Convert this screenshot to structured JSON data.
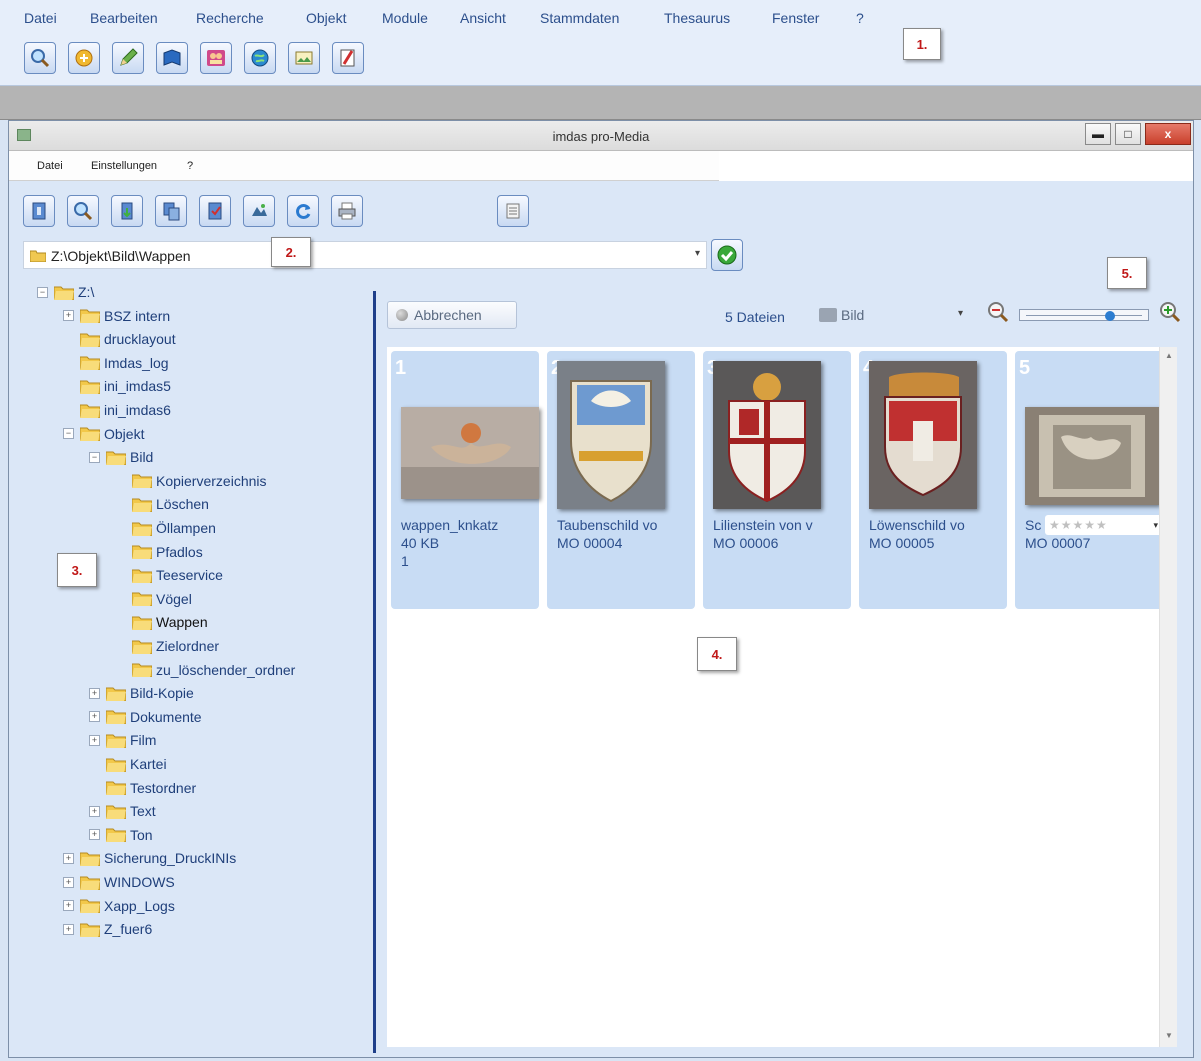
{
  "app_menu": [
    "Datei",
    "Bearbeiten",
    "Recherche",
    "Objekt",
    "Module",
    "Ansicht",
    "Stammdaten",
    "Thesaurus",
    "Fenster",
    "?"
  ],
  "app_toolbar_icons": [
    "search-icon",
    "folder-open-icon",
    "pencil-icon",
    "book-icon",
    "persons-icon",
    "globe-icon",
    "image-icon",
    "checklist-icon"
  ],
  "callouts": {
    "c1": "1.",
    "c2": "2.",
    "c3": "3.",
    "c4": "4.",
    "c5": "5."
  },
  "window": {
    "title": "imdas pro-Media",
    "menu": [
      "Datei",
      "Einstellungen",
      "?"
    ],
    "controls": {
      "minimize": "▬",
      "maximize": "□",
      "close": "x"
    }
  },
  "win_toolbar_icons": [
    "exit-icon",
    "search-icon",
    "import-icon",
    "copy-icon",
    "check-icon",
    "images-icon",
    "refresh-icon",
    "print-icon",
    "list-icon"
  ],
  "path": {
    "value": "Z:\\Objekt\\Bild\\Wappen",
    "dropdown": "▾"
  },
  "tree": [
    {
      "label": "Z:\\",
      "level": 0,
      "toggle": "−"
    },
    {
      "label": "BSZ intern",
      "level": 1,
      "toggle": "+"
    },
    {
      "label": "drucklayout",
      "level": 1,
      "toggle": ""
    },
    {
      "label": "Imdas_log",
      "level": 1,
      "toggle": ""
    },
    {
      "label": "ini_imdas5",
      "level": 1,
      "toggle": ""
    },
    {
      "label": "ini_imdas6",
      "level": 1,
      "toggle": ""
    },
    {
      "label": "Objekt",
      "level": 1,
      "toggle": "−"
    },
    {
      "label": "Bild",
      "level": 2,
      "toggle": "−"
    },
    {
      "label": "Kopierverzeichnis",
      "level": 3,
      "toggle": ""
    },
    {
      "label": "Löschen",
      "level": 3,
      "toggle": ""
    },
    {
      "label": "Öllampen",
      "level": 3,
      "toggle": ""
    },
    {
      "label": "Pfadlos",
      "level": 3,
      "toggle": ""
    },
    {
      "label": "Teeservice",
      "level": 3,
      "toggle": ""
    },
    {
      "label": "Vögel",
      "level": 3,
      "toggle": ""
    },
    {
      "label": "Wappen",
      "level": 3,
      "toggle": "",
      "selected": true
    },
    {
      "label": "Zielordner",
      "level": 3,
      "toggle": ""
    },
    {
      "label": "zu_löschender_ordner",
      "level": 3,
      "toggle": ""
    },
    {
      "label": "Bild-Kopie",
      "level": 2,
      "toggle": "+"
    },
    {
      "label": "Dokumente",
      "level": 2,
      "toggle": "+"
    },
    {
      "label": "Film",
      "level": 2,
      "toggle": "+"
    },
    {
      "label": "Kartei",
      "level": 2,
      "toggle": ""
    },
    {
      "label": "Testordner",
      "level": 2,
      "toggle": ""
    },
    {
      "label": "Text",
      "level": 2,
      "toggle": "+"
    },
    {
      "label": "Ton",
      "level": 2,
      "toggle": "+"
    },
    {
      "label": "Sicherung_DruckINIs",
      "level": 1,
      "toggle": "+"
    },
    {
      "label": "WINDOWS",
      "level": 1,
      "toggle": "+"
    },
    {
      "label": "Xapp_Logs",
      "level": 1,
      "toggle": "+"
    },
    {
      "label": "Z_fuer6",
      "level": 1,
      "toggle": "+"
    }
  ],
  "right": {
    "cancel_label": "Abbrechen",
    "file_count": "5 Dateien",
    "type_select": "Bild",
    "zoom_level": 0.7
  },
  "cards": [
    {
      "num": "1",
      "line1": "wappen_knkatz",
      "line2": "40 KB",
      "line3": "1",
      "thumb": "landscape-beige"
    },
    {
      "num": "2",
      "line1": "Taubenschild vo",
      "line2": "MO 00004",
      "line3": "",
      "thumb": "shield-dove"
    },
    {
      "num": "3",
      "line1": "Lilienstein von v",
      "line2": "MO 00006",
      "line3": "",
      "thumb": "shield-lily"
    },
    {
      "num": "4",
      "line1": "Löwenschild vo",
      "line2": "MO 00005",
      "line3": "",
      "thumb": "shield-lion"
    },
    {
      "num": "5",
      "line1": "Sc",
      "line2": "MO 00007",
      "line3": "",
      "thumb": "stone-relief",
      "rating": "★★★★★"
    }
  ],
  "colors": {
    "accent": "#2c4f8c",
    "card_bg": "#c8dcf4",
    "separator": "#1f3f8a"
  }
}
